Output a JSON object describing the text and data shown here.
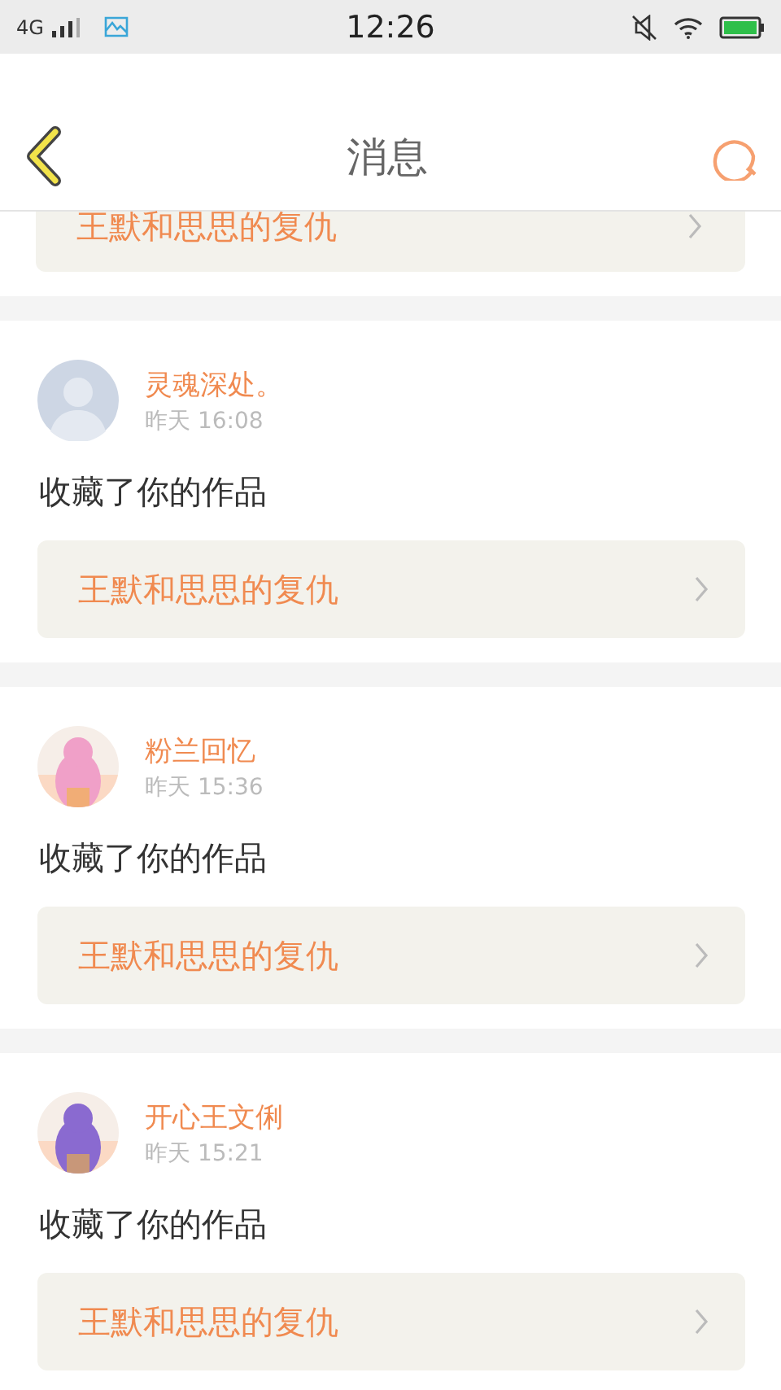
{
  "status_bar": {
    "network": "4G",
    "time": "12:26"
  },
  "header": {
    "title": "消息"
  },
  "partial_card": {
    "work": "王默和思思的复仇"
  },
  "messages": [
    {
      "user": "灵魂深处。",
      "time": "昨天 16:08",
      "action": "收藏了你的作品",
      "work": "王默和思思的复仇",
      "avatar": {
        "kind": "default"
      }
    },
    {
      "user": "粉兰回忆",
      "time": "昨天 15:36",
      "action": "收藏了你的作品",
      "work": "王默和思思的复仇"
    },
    {
      "user": "开心王文俐",
      "time": "昨天 15:21",
      "action": "收藏了你的作品",
      "work": "王默和思思的复仇"
    }
  ]
}
